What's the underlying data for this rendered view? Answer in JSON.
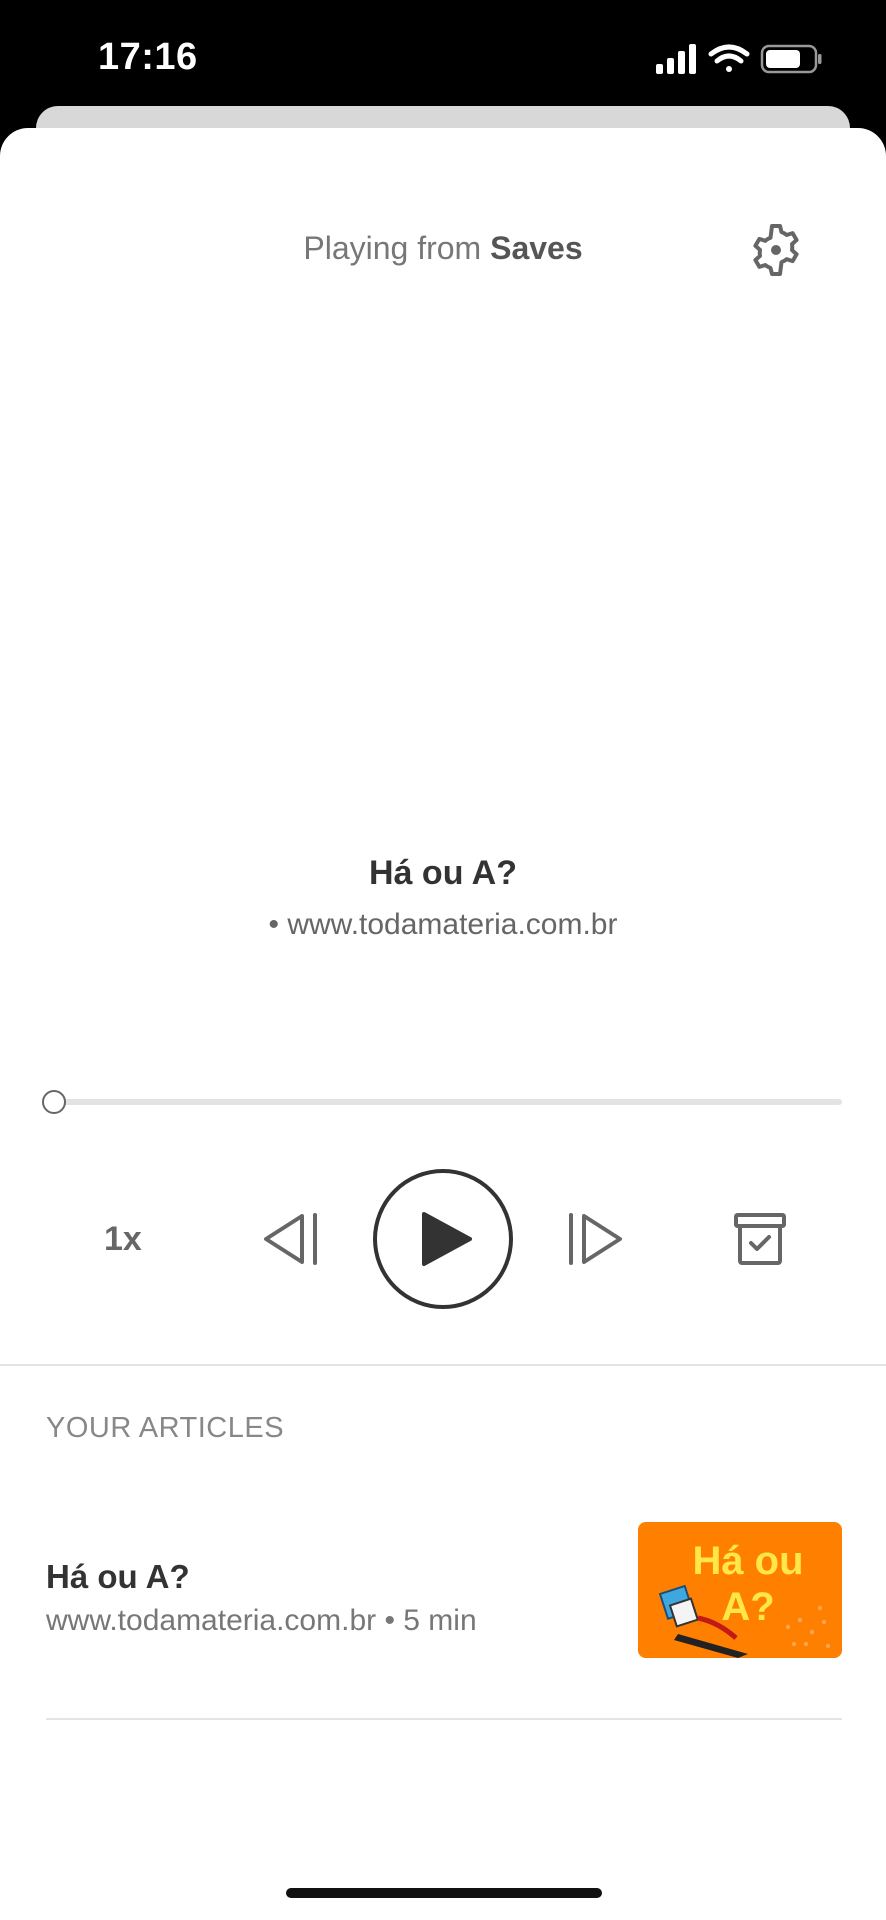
{
  "status": {
    "time": "17:16"
  },
  "header": {
    "playing_prefix": "Playing from ",
    "playing_source": "Saves"
  },
  "now_playing": {
    "title": "Há ou A?",
    "source": "• www.todamateria.com.br",
    "progress": 0.0
  },
  "controls": {
    "speed_label": "1x"
  },
  "articles_section": {
    "label": "YOUR ARTICLES",
    "items": [
      {
        "title": "Há ou A?",
        "meta": "www.todamateria.com.br • 5 min",
        "thumb_text": "Há ou A?"
      }
    ]
  },
  "colors": {
    "accent": "#333333",
    "thumbnail_bg": "#ff7f00",
    "thumbnail_text": "#ffe74a"
  }
}
